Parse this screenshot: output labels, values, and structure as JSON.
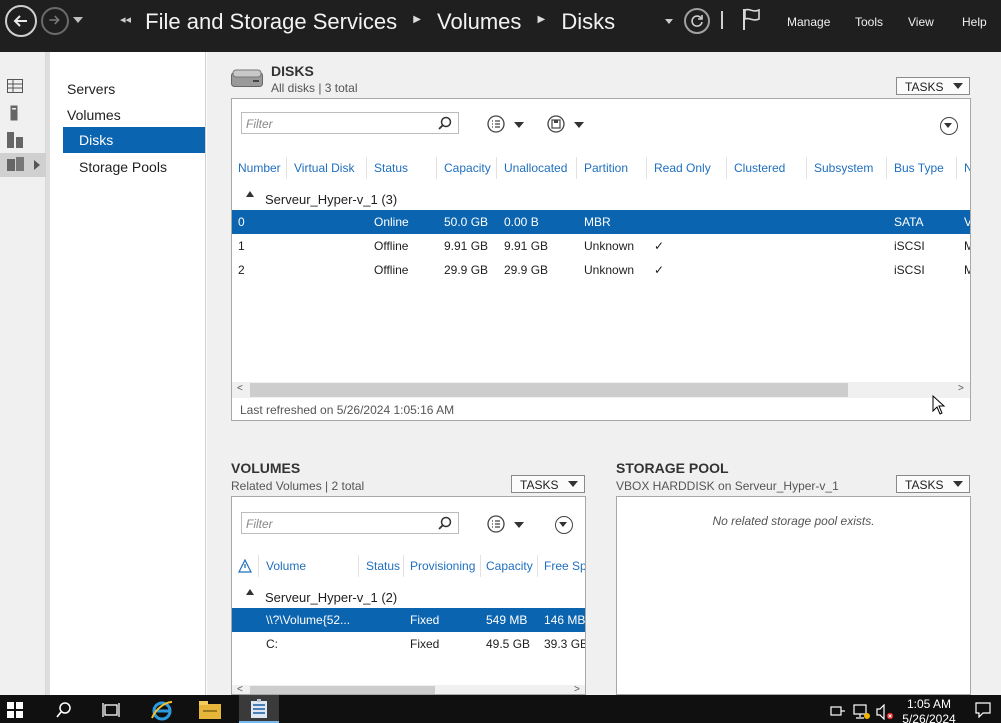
{
  "window": {
    "breadcrumb": [
      "File and Storage Services",
      "Volumes",
      "Disks"
    ],
    "menu": [
      "Manage",
      "Tools",
      "View",
      "Help"
    ]
  },
  "nav": {
    "items": [
      "Servers",
      "Volumes",
      "Disks",
      "Storage Pools"
    ],
    "selected": "Disks"
  },
  "disks": {
    "title": "DISKS",
    "subtitle": "All disks | 3 total",
    "tasks_label": "TASKS",
    "filter_placeholder": "Filter",
    "columns": [
      "Number",
      "Virtual Disk",
      "Status",
      "Capacity",
      "Unallocated",
      "Partition",
      "Read Only",
      "Clustered",
      "Subsystem",
      "Bus Type",
      "N"
    ],
    "group": "Serveur_Hyper-v_1 (3)",
    "rows": [
      {
        "number": "0",
        "virtual_disk": "",
        "status": "Online",
        "capacity": "50.0 GB",
        "unallocated": "0.00 B",
        "partition": "MBR",
        "read_only": "",
        "clustered": "",
        "subsystem": "",
        "bus_type": "SATA",
        "name": "V"
      },
      {
        "number": "1",
        "virtual_disk": "",
        "status": "Offline",
        "capacity": "9.91 GB",
        "unallocated": "9.91 GB",
        "partition": "Unknown",
        "read_only": "✓",
        "clustered": "",
        "subsystem": "",
        "bus_type": "iSCSI",
        "name": "M"
      },
      {
        "number": "2",
        "virtual_disk": "",
        "status": "Offline",
        "capacity": "29.9 GB",
        "unallocated": "29.9 GB",
        "partition": "Unknown",
        "read_only": "✓",
        "clustered": "",
        "subsystem": "",
        "bus_type": "iSCSI",
        "name": "M"
      }
    ],
    "selected_row": 0,
    "last_refreshed": "Last refreshed on 5/26/2024 1:05:16 AM"
  },
  "volumes": {
    "title": "VOLUMES",
    "subtitle": "Related Volumes | 2 total",
    "tasks_label": "TASKS",
    "filter_placeholder": "Filter",
    "columns": [
      "Volume",
      "Status",
      "Provisioning",
      "Capacity",
      "Free Spa"
    ],
    "group": "Serveur_Hyper-v_1 (2)",
    "rows": [
      {
        "volume": "\\\\?\\Volume{52...",
        "status": "",
        "provisioning": "Fixed",
        "capacity": "549 MB",
        "free": "146 MB"
      },
      {
        "volume": "C:",
        "status": "",
        "provisioning": "Fixed",
        "capacity": "49.5 GB",
        "free": "39.3 GB"
      }
    ],
    "selected_row": 0
  },
  "storage_pool": {
    "title": "STORAGE POOL",
    "subtitle": "VBOX HARDDISK on Serveur_Hyper-v_1",
    "tasks_label": "TASKS",
    "empty_message": "No related storage pool exists."
  },
  "taskbar": {
    "time": "1:05 AM",
    "date": "5/26/2024"
  },
  "colors": {
    "selection": "#0a64b0",
    "header_text": "#1f6fbf",
    "titlebar": "#1f1f1f"
  }
}
